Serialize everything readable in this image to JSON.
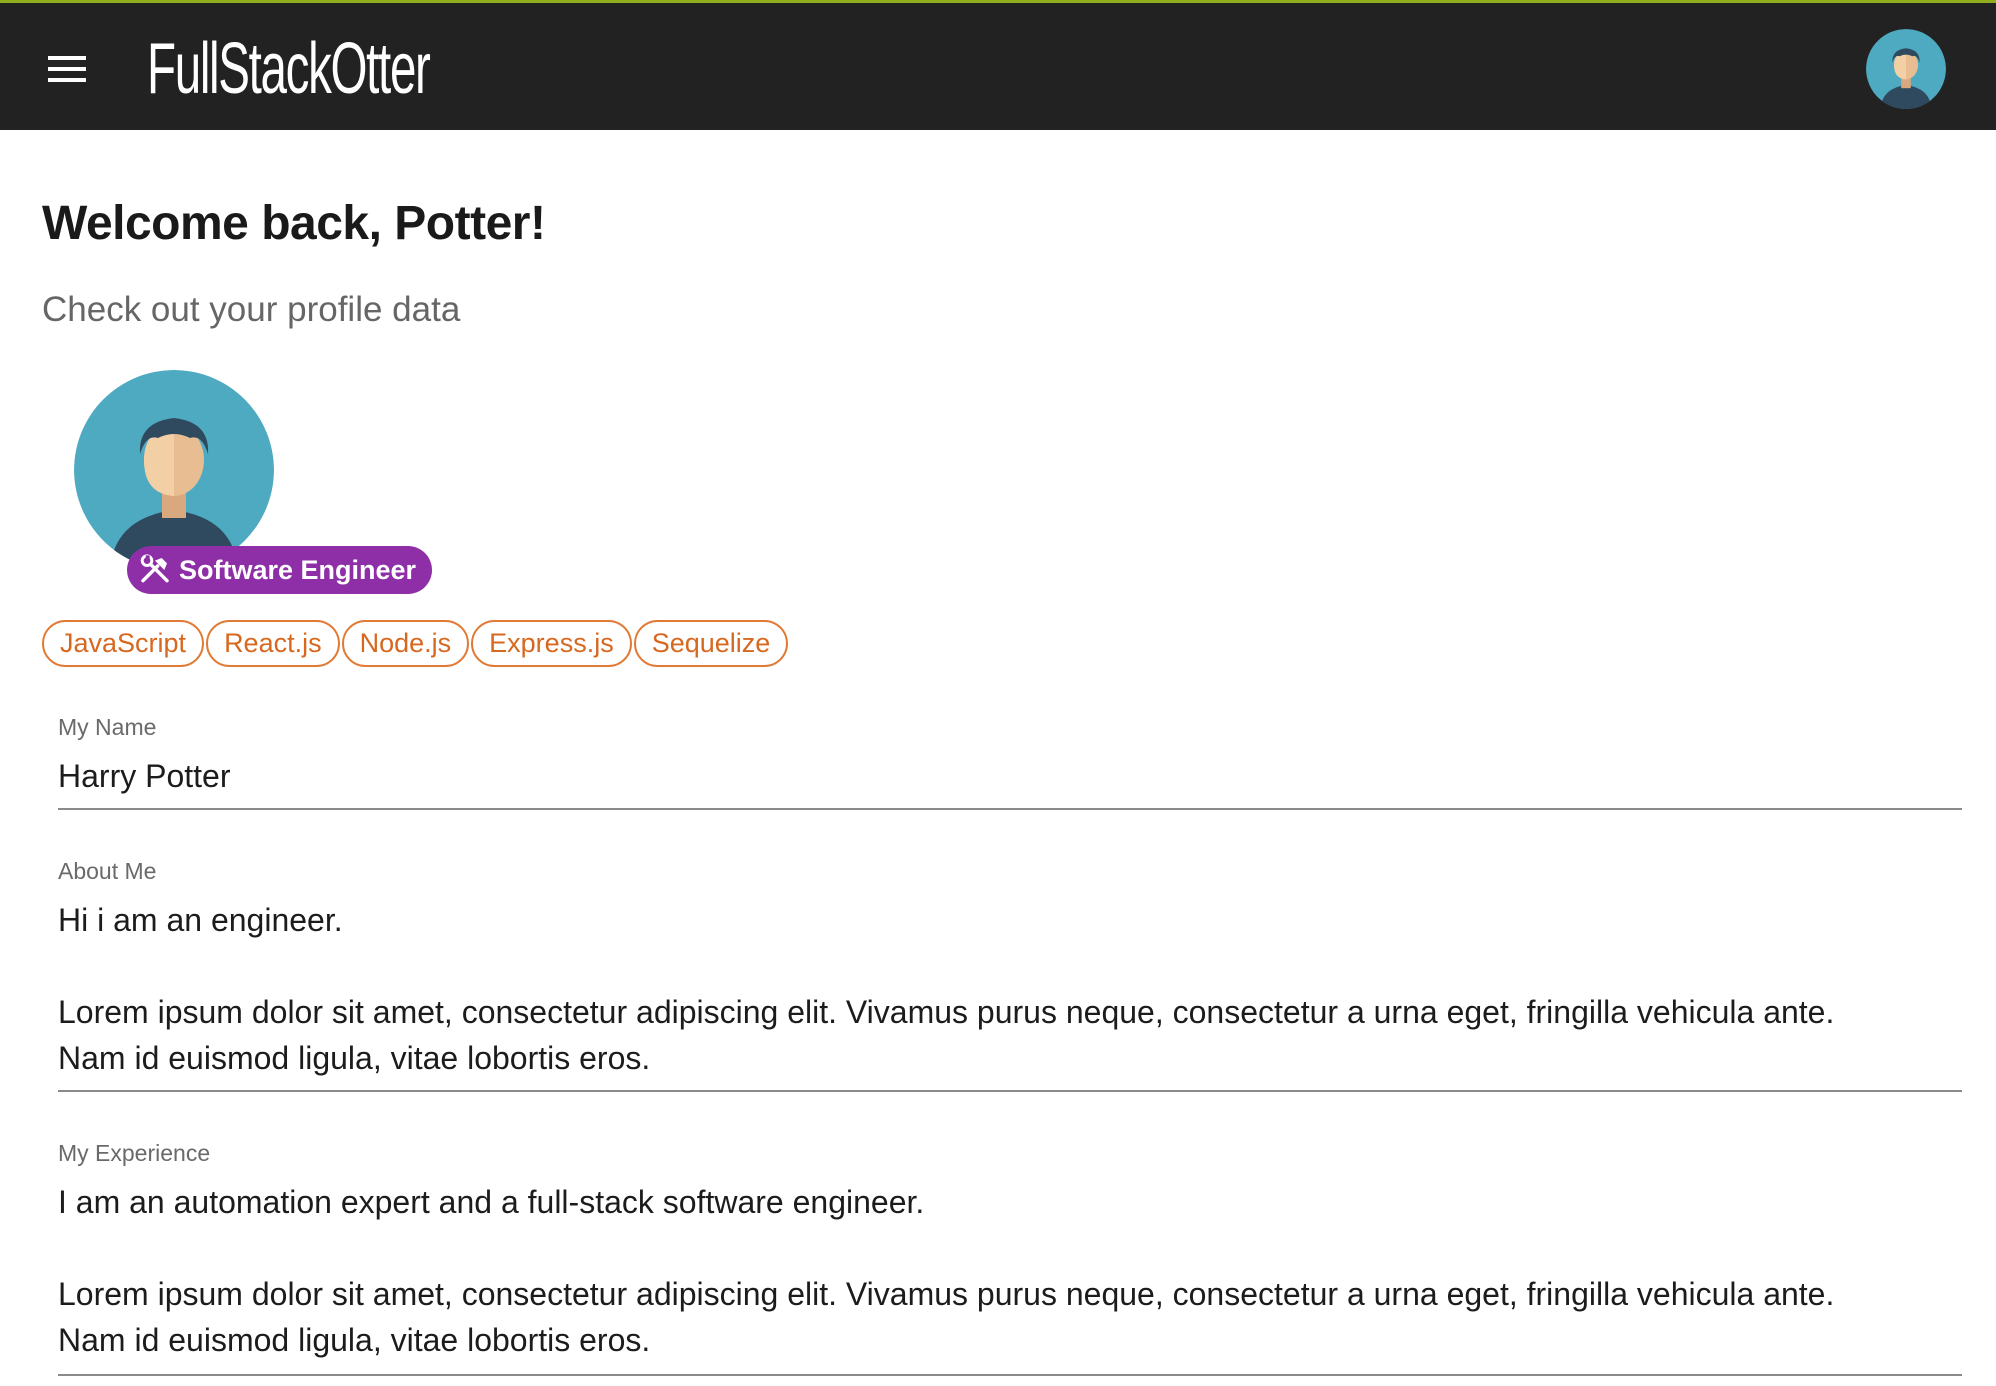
{
  "app": {
    "logo_text": "FullStackOtter"
  },
  "header": {
    "welcome": "Welcome back, Potter!",
    "subtitle": "Check out your profile data"
  },
  "profile": {
    "role": "Software Engineer",
    "skills": [
      "JavaScript",
      "React.js",
      "Node.js",
      "Express.js",
      "Sequelize"
    ]
  },
  "fields": {
    "name": {
      "label": "My Name",
      "value": "Harry Potter"
    },
    "about": {
      "label": "About Me",
      "value": "Hi i am an engineer.\n\nLorem ipsum dolor sit amet, consectetur adipiscing elit. Vivamus purus neque, consectetur a urna eget, fringilla vehicula ante.\nNam id euismod ligula, vitae lobortis eros."
    },
    "experience": {
      "label": "My Experience",
      "value": "I am an automation expert and a full-stack software engineer.\n\nLorem ipsum dolor sit amet, consectetur adipiscing elit. Vivamus purus neque, consectetur a urna eget, fringilla vehicula ante.\nNam id euismod ligula, vitae lobortis eros."
    }
  },
  "colors": {
    "topbar": "#222222",
    "topbar_accent": "#8fae1b",
    "role_badge": "#8e2fa8",
    "chip": "#e07a35",
    "avatar_bg": "#4eaac1"
  },
  "icons": {
    "menu": "hamburger-menu-icon",
    "role": "hammer-wrench-icon",
    "avatar": "user-avatar-icon"
  }
}
